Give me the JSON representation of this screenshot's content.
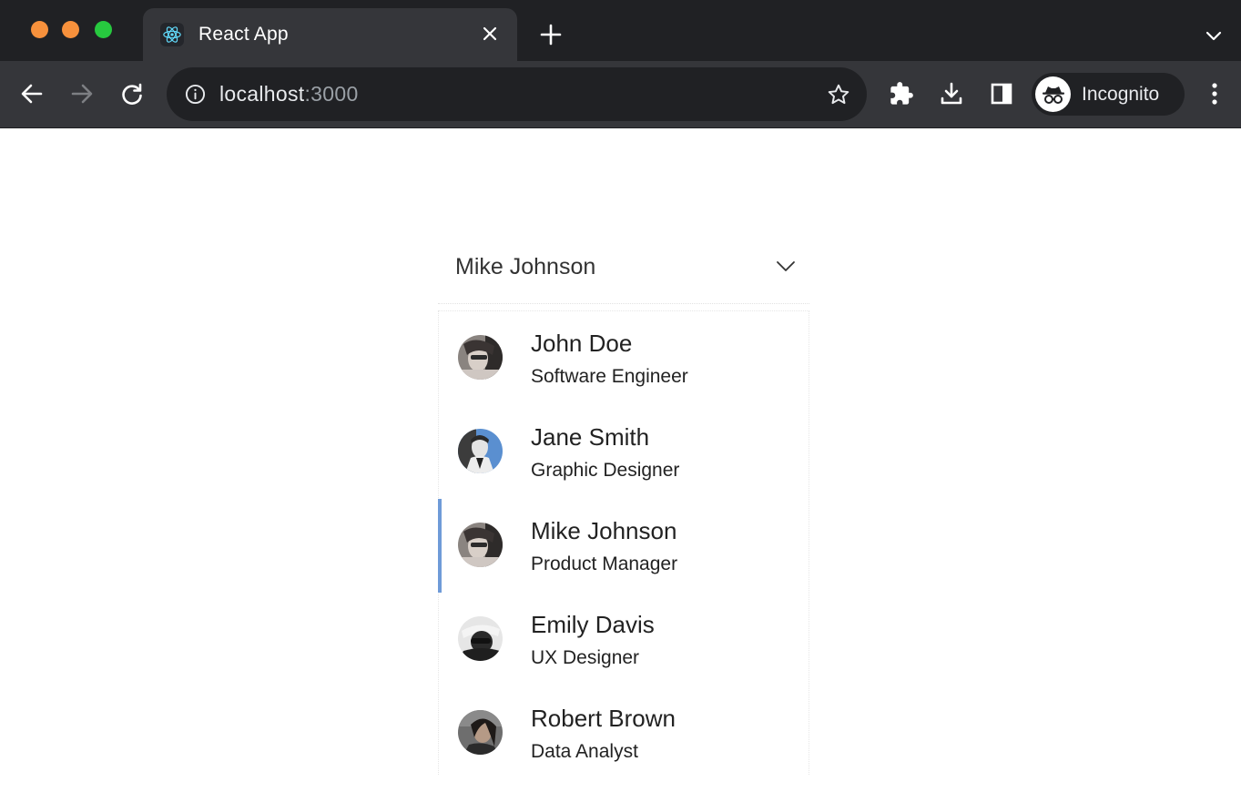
{
  "browser": {
    "tab_title": "React App",
    "url_host": "localhost",
    "url_port": ":3000",
    "profile_label": "Incognito",
    "icons": {
      "window": [
        "close-dot",
        "minimize-dot",
        "maximize-dot"
      ],
      "toolbar": [
        "back-arrow-icon",
        "forward-arrow-icon",
        "reload-icon",
        "info-icon",
        "star-icon",
        "puzzle-icon",
        "download-icon",
        "side-panel-icon",
        "incognito-icon",
        "kebab-menu-icon"
      ]
    },
    "colors": {
      "traffic_red_orange": "#f7913c",
      "traffic_green": "#27c93f",
      "chrome_dark": "#202124",
      "chrome_tab": "#35363a"
    }
  },
  "select": {
    "selected_label": "Mike Johnson",
    "accent": "#6f9bd8",
    "options": [
      {
        "name": "John Doe",
        "role": "Software Engineer"
      },
      {
        "name": "Jane Smith",
        "role": "Graphic Designer"
      },
      {
        "name": "Mike Johnson",
        "role": "Product Manager",
        "selected": true
      },
      {
        "name": "Emily Davis",
        "role": "UX Designer"
      },
      {
        "name": "Robert Brown",
        "role": "Data Analyst"
      }
    ]
  }
}
